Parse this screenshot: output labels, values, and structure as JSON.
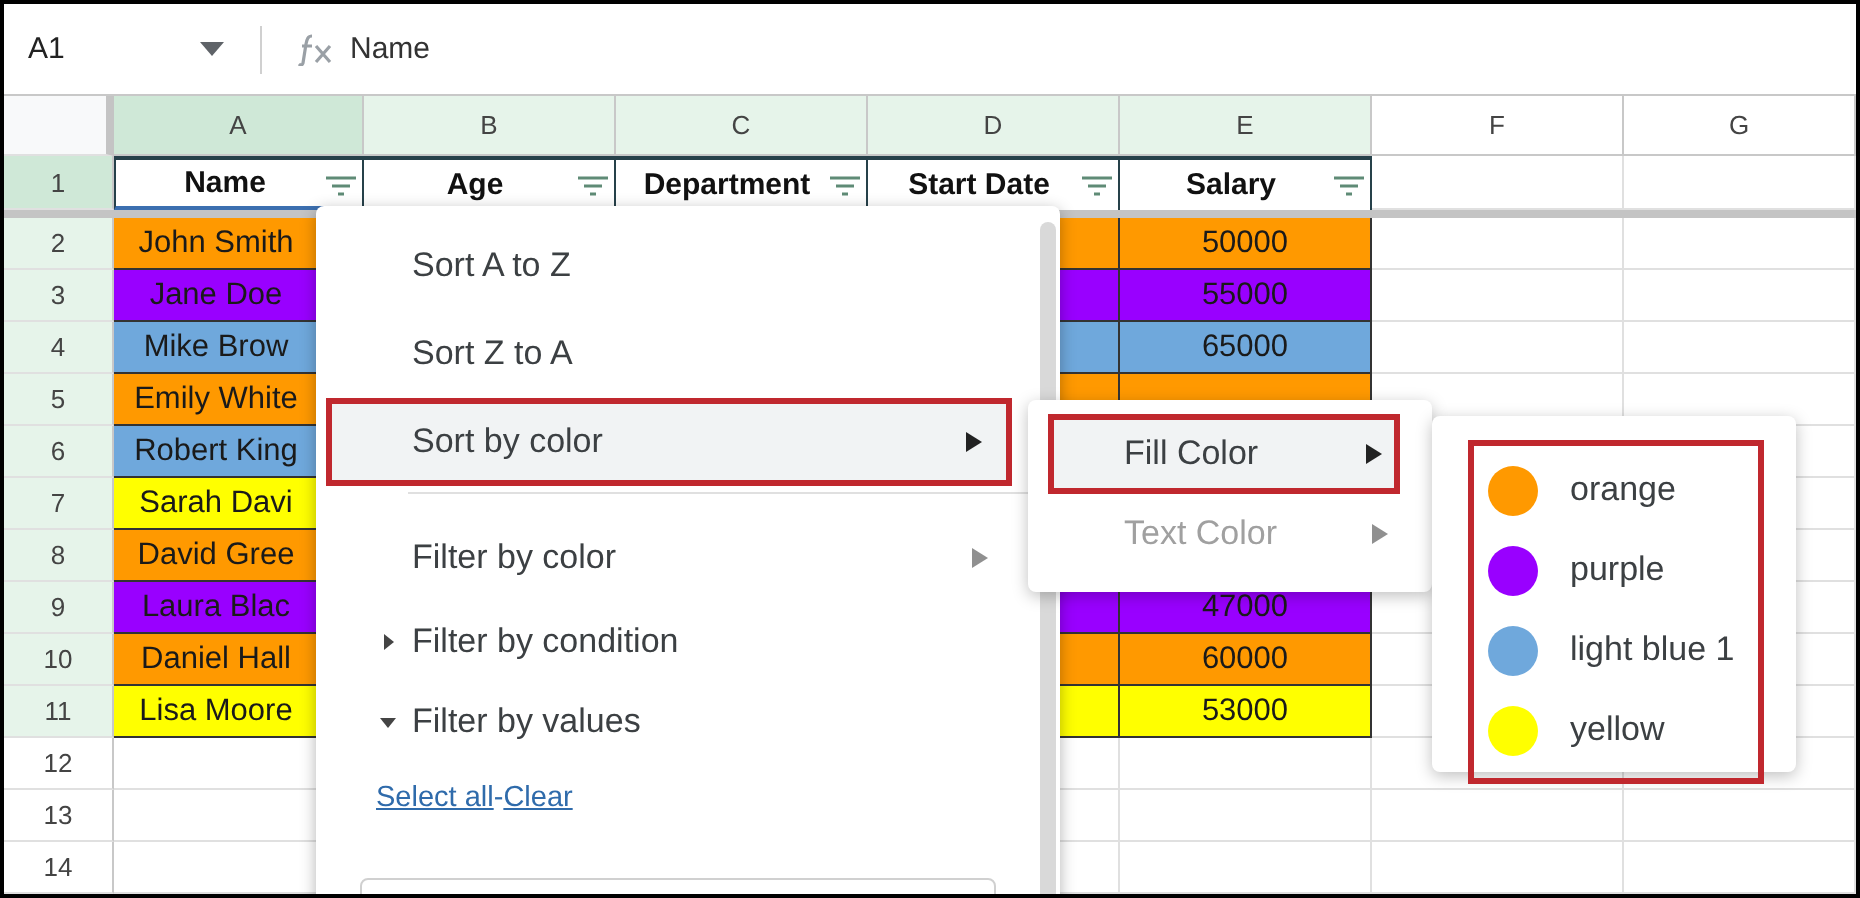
{
  "formula_bar": {
    "cell_ref": "A1",
    "formula": "Name"
  },
  "columns": [
    {
      "letter": "A",
      "selected": true,
      "highlighted": true
    },
    {
      "letter": "B",
      "selected": false,
      "highlighted": true
    },
    {
      "letter": "C",
      "selected": false,
      "highlighted": true
    },
    {
      "letter": "D",
      "selected": false,
      "highlighted": true
    },
    {
      "letter": "E",
      "selected": false,
      "highlighted": true
    },
    {
      "letter": "F",
      "selected": false,
      "highlighted": false
    },
    {
      "letter": "G",
      "selected": false,
      "highlighted": false
    }
  ],
  "header_row": {
    "number": "1",
    "cells": [
      {
        "text": "Name",
        "filter": true
      },
      {
        "text": "Age",
        "filter": true
      },
      {
        "text": "Department",
        "filter": true
      },
      {
        "text": "Start Date",
        "filter": true
      },
      {
        "text": "Salary",
        "filter": true
      }
    ]
  },
  "rows": [
    {
      "number": "2",
      "color": "#ff9900",
      "name": "John Smith",
      "salary": "50000"
    },
    {
      "number": "3",
      "color": "#9900ff",
      "name": "Jane Doe",
      "salary": "55000"
    },
    {
      "number": "4",
      "color": "#6fa8dc",
      "name": "Mike Brow",
      "salary": "65000"
    },
    {
      "number": "5",
      "color": "#ff9900",
      "name": "Emily White"
    },
    {
      "number": "6",
      "color": "#6fa8dc",
      "name": "Robert King"
    },
    {
      "number": "7",
      "color": "#ffff00",
      "name": "Sarah Davi"
    },
    {
      "number": "8",
      "color": "#ff9900",
      "name": "David Gree"
    },
    {
      "number": "9",
      "color": "#9900ff",
      "name": "Laura Blac",
      "salary": "47000"
    },
    {
      "number": "10",
      "color": "#ff9900",
      "name": "Daniel Hall",
      "salary": "60000"
    },
    {
      "number": "11",
      "color": "#ffff00",
      "name": "Lisa Moore",
      "salary": "53000"
    }
  ],
  "empty_rows": [
    "12",
    "13",
    "14"
  ],
  "sort_menu": {
    "items": [
      {
        "kind": "action",
        "label": "Sort A to Z",
        "selected": false
      },
      {
        "kind": "action",
        "label": "Sort Z to A",
        "selected": false
      },
      {
        "kind": "submenu",
        "label": "Sort by color",
        "selected": true
      },
      {
        "kind": "divider"
      },
      {
        "kind": "submenu",
        "label": "Filter by color",
        "selected": false
      },
      {
        "kind": "section",
        "label": "Filter by condition",
        "expanded": false
      },
      {
        "kind": "section",
        "label": "Filter by values",
        "expanded": true
      }
    ],
    "links": {
      "select_all": "Select all",
      "separator": "-",
      "clear": "Clear"
    }
  },
  "color_type_menu": {
    "items": [
      {
        "label": "Fill Color",
        "selected": true,
        "disabled": false
      },
      {
        "label": "Text Color",
        "selected": false,
        "disabled": true
      }
    ]
  },
  "fill_colors": [
    {
      "label": "orange",
      "color": "#ff9900"
    },
    {
      "label": "purple",
      "color": "#9900ff"
    },
    {
      "label": "light blue 1",
      "color": "#6fa8dc"
    },
    {
      "label": "yellow",
      "color": "#ffff00"
    }
  ]
}
